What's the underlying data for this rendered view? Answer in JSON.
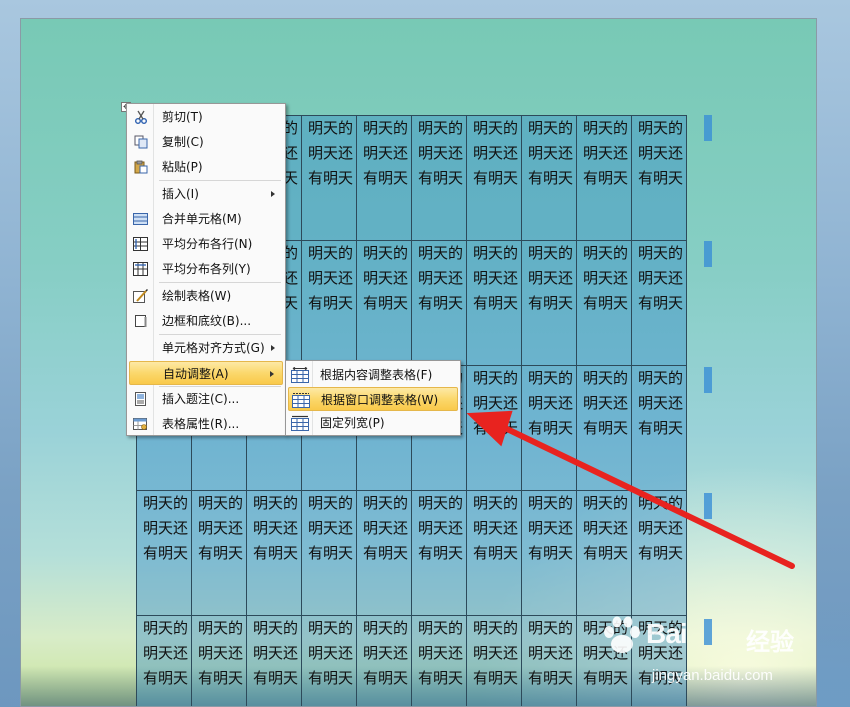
{
  "table": {
    "cell_text": "明天的明天还有明天",
    "rows": 5,
    "cols": 10
  },
  "context_menu": {
    "items": [
      {
        "label": "剪切(T)",
        "icon": "scissors-icon"
      },
      {
        "label": "复制(C)",
        "icon": "copy-icon"
      },
      {
        "label": "粘贴(P)",
        "icon": "paste-icon"
      },
      {
        "label": "插入(I)",
        "icon": "",
        "submenu": true
      },
      {
        "label": "合并单元格(M)",
        "icon": "merge-cells-icon"
      },
      {
        "label": "平均分布各行(N)",
        "icon": "distribute-rows-icon"
      },
      {
        "label": "平均分布各列(Y)",
        "icon": "distribute-columns-icon"
      },
      {
        "label": "绘制表格(W)",
        "icon": "draw-table-icon"
      },
      {
        "label": "边框和底纹(B)...",
        "icon": "borders-shading-icon"
      },
      {
        "label": "单元格对齐方式(G)",
        "icon": "",
        "submenu": true
      },
      {
        "label": "自动调整(A)",
        "icon": "",
        "submenu": true,
        "highlighted": true
      },
      {
        "label": "插入题注(C)...",
        "icon": "insert-caption-icon"
      },
      {
        "label": "表格属性(R)...",
        "icon": "table-properties-icon"
      }
    ]
  },
  "auto_fit_submenu": {
    "items": [
      {
        "label": "根据内容调整表格(F)",
        "icon": "autofit-contents-icon"
      },
      {
        "label": "根据窗口调整表格(W)",
        "icon": "autofit-window-icon",
        "highlighted": true
      },
      {
        "label": "固定列宽(P)",
        "icon": "fixed-column-width-icon"
      }
    ]
  },
  "watermark": {
    "logo": "Bai",
    "logo_tail": "经验",
    "url": "jingyan.baidu.com"
  },
  "colors": {
    "annotation_arrow": "#e8231f",
    "menu_highlight": "#fbd86c",
    "table_fill": "#348ac8"
  }
}
